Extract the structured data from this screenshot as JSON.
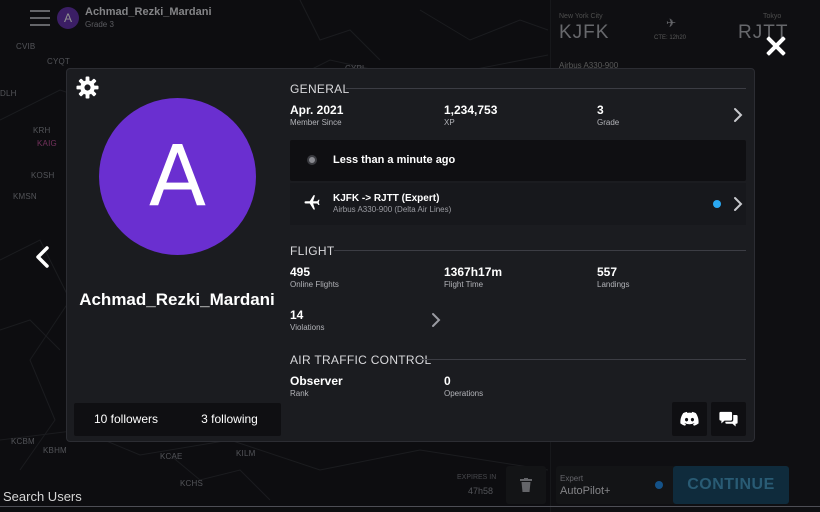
{
  "background": {
    "topbar": {
      "user_initial": "A",
      "user_name": "Achmad_Rezki_Mardani",
      "user_grade": "Grade 3"
    },
    "waypoints": [
      "CVIB",
      "CYQT",
      "DLH",
      "KRH",
      "KAIG",
      "KOSH",
      "KMSN",
      "KCBM",
      "KBHM",
      "KCAE",
      "KCHS",
      "KILM",
      "CYPL"
    ],
    "flight_panel": {
      "from_city": "New York City",
      "from_code": "KJFK",
      "to_city": "Tokyo",
      "to_code": "RJTT",
      "cte": "CTE: 12h20",
      "aircraft": "Airbus A330-900"
    },
    "bottom": {
      "search_label": "Search Users",
      "expires_label": "EXPIRES IN",
      "expires_value": "47h58",
      "autopilot_label": "Expert",
      "autopilot_value": "AutoPilot+",
      "continue_label": "CONTINUE"
    }
  },
  "profile": {
    "avatar_initial": "A",
    "avatar_color": "#6a2fd0",
    "username": "Achmad_Rezki_Mardani",
    "followers": "10 followers",
    "following": "3 following"
  },
  "general": {
    "title": "GENERAL",
    "member_since": {
      "value": "Apr. 2021",
      "label": "Member Since"
    },
    "xp": {
      "value": "1,234,753",
      "label": "XP"
    },
    "grade": {
      "value": "3",
      "label": "Grade"
    },
    "status": "Less than a minute ago",
    "current_flight": {
      "route": "KJFK -> RJTT (Expert)",
      "aircraft": "Airbus A330-900 (Delta Air Lines)"
    }
  },
  "flight": {
    "title": "FLIGHT",
    "online_flights": {
      "value": "495",
      "label": "Online Flights"
    },
    "flight_time": {
      "value": "1367h17m",
      "label": "Flight Time"
    },
    "landings": {
      "value": "557",
      "label": "Landings"
    },
    "violations": {
      "value": "14",
      "label": "Violations"
    }
  },
  "atc": {
    "title": "AIR TRAFFIC CONTROL",
    "rank": {
      "value": "Observer",
      "label": "Rank"
    },
    "operations": {
      "value": "0",
      "label": "Operations"
    }
  },
  "icons": {
    "close": "close-icon",
    "back": "chevron-left-icon",
    "settings": "gear-icon",
    "discord": "discord-icon",
    "chat": "chat-icon",
    "plane": "airplane-icon"
  }
}
